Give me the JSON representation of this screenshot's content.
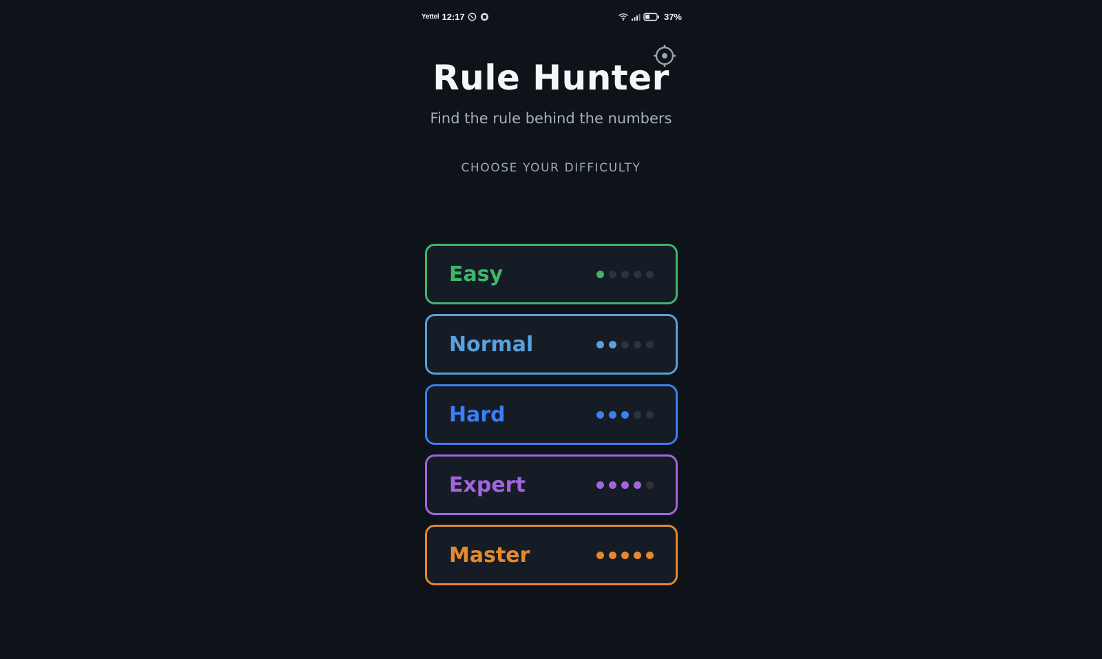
{
  "status_bar": {
    "carrier": "Yettel",
    "time": "12:17",
    "battery": "37%",
    "icons": [
      "viber-icon",
      "notification-icon",
      "wifi-icon",
      "signal-icon",
      "battery-icon"
    ]
  },
  "header": {
    "settings_icon": "gear-icon",
    "title": "Rule Hunter",
    "subtitle": "Find the rule behind the numbers"
  },
  "difficulty": {
    "heading": "CHOOSE YOUR DIFFICULTY",
    "inactive_dot_color": "#2c333e",
    "levels": [
      {
        "label": "Easy",
        "color": "#3fb66a",
        "rating": 1,
        "max_rating": 5
      },
      {
        "label": "Normal",
        "color": "#5aa0db",
        "rating": 2,
        "max_rating": 5
      },
      {
        "label": "Hard",
        "color": "#3c7ff2",
        "rating": 3,
        "max_rating": 5
      },
      {
        "label": "Expert",
        "color": "#a265de",
        "rating": 4,
        "max_rating": 5
      },
      {
        "label": "Master",
        "color": "#e4892d",
        "rating": 5,
        "max_rating": 5
      }
    ]
  },
  "colors": {
    "background": "#0e131a",
    "card_background": "#161c26",
    "title": "#f4f6f8",
    "subtitle": "#a9b1bc"
  }
}
